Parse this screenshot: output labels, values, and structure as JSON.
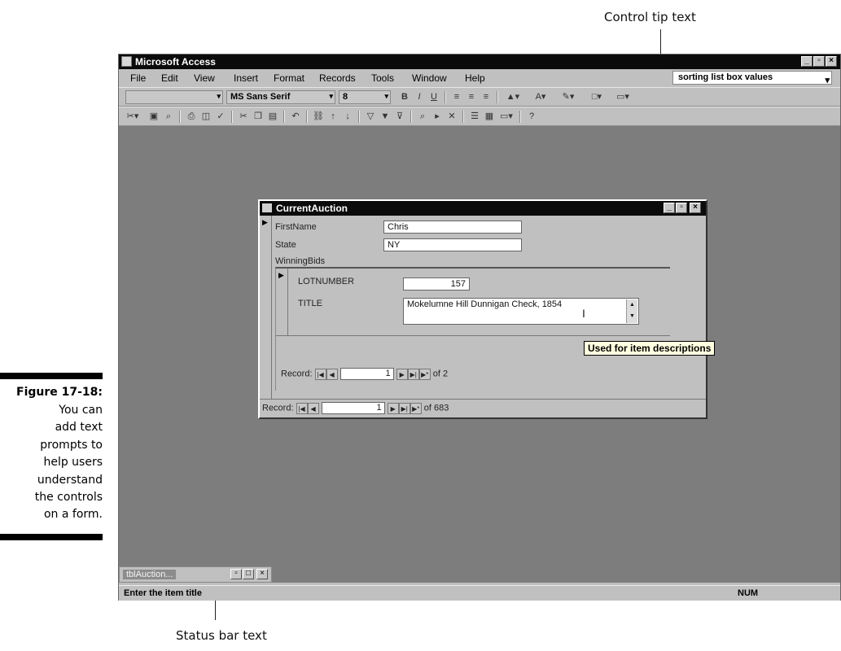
{
  "callouts": {
    "control_tip": "Control tip text",
    "status_bar": "Status bar text"
  },
  "figure": {
    "number": "Figure 17-18:",
    "caption_lines": [
      "You can",
      "add text",
      "prompts to",
      "help users",
      "understand",
      "the controls",
      "on a form."
    ]
  },
  "app": {
    "title": "Microsoft Access",
    "menu": [
      "File",
      "Edit",
      "View",
      "Insert",
      "Format",
      "Records",
      "Tools",
      "Window",
      "Help"
    ],
    "help_search": "sorting list box values",
    "font_name": "MS Sans Serif",
    "font_size": "8"
  },
  "form": {
    "title": "CurrentAuction",
    "firstname_label": "FirstName",
    "firstname_value": "Chris",
    "state_label": "State",
    "state_value": "NY",
    "subform_label": "WinningBids",
    "lot_label": "LOTNUMBER",
    "lot_value": "157",
    "title_label": "TITLE",
    "title_value": "Mokelumne Hill Dunnigan Check, 1854",
    "tooltip": "Used for item descriptions",
    "sub_nav": {
      "label": "Record:",
      "current": "1",
      "of": "of 2"
    },
    "main_nav": {
      "label": "Record:",
      "current": "1",
      "of": "of 683"
    }
  },
  "minimized_label": "tblAuction...",
  "status": {
    "text": "Enter the item title",
    "num": "NUM"
  },
  "colors": {
    "title_bar": "#0b0b0b",
    "workspace": "#7d7d7d",
    "chrome": "#c0c0c0",
    "tooltip_bg": "#ffffe1"
  }
}
